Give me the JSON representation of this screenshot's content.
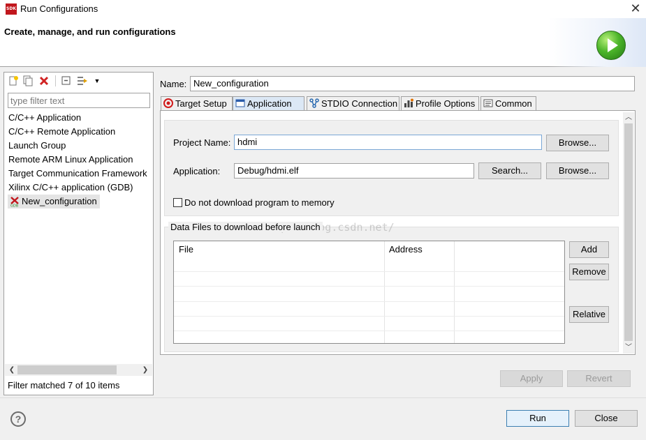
{
  "window": {
    "app_icon": "SDK",
    "title": "Run Configurations",
    "close_glyph": "✕"
  },
  "banner": {
    "title": "Create, manage, and run configurations",
    "icon": "run-icon"
  },
  "left_toolbar": {
    "icons": [
      "new-config-icon",
      "duplicate-icon",
      "delete-icon",
      "collapse-all-icon",
      "filter-icon",
      "dropdown-icon"
    ]
  },
  "filter": {
    "placeholder": "type filter text",
    "value": "",
    "status": "Filter matched 7 of 10 items"
  },
  "tree": {
    "items": [
      "C/C++ Application",
      "C/C++ Remote Application",
      "Launch Group",
      "Remote ARM Linux Application",
      "Target Communication Framework",
      "Xilinx C/C++ application (GDB)",
      "New_configuration"
    ],
    "selected": "New_configuration"
  },
  "config": {
    "name_label": "Name:",
    "name_value": "New_configuration"
  },
  "tabs": [
    {
      "label": "Target Setup",
      "icon": "target-icon",
      "active": false
    },
    {
      "label": "Application",
      "icon": "window-icon",
      "active": true
    },
    {
      "label": "STDIO Connection",
      "icon": "connection-icon",
      "active": false
    },
    {
      "label": "Profile Options",
      "icon": "profile-icon",
      "active": false
    },
    {
      "label": "Common",
      "icon": "common-icon",
      "active": false
    }
  ],
  "application_tab": {
    "project_label": "Project Name:",
    "project_value": "hdmi",
    "project_browse": "Browse...",
    "app_label": "Application:",
    "app_value": "Debug/hdmi.elf",
    "app_search": "Search...",
    "app_browse": "Browse...",
    "no_download_label": "Do not download program to memory",
    "no_download_checked": false,
    "data_files_label": "Data Files to download before launch",
    "watermark": "http://blog.csdn.net/",
    "table_columns": [
      "File",
      "Address"
    ],
    "table_rows": [],
    "add_button": "Add",
    "remove_button": "Remove",
    "relative_button": "Relative"
  },
  "footer": {
    "apply": "Apply",
    "revert": "Revert",
    "run": "Run",
    "close": "Close",
    "help_glyph": "?"
  }
}
